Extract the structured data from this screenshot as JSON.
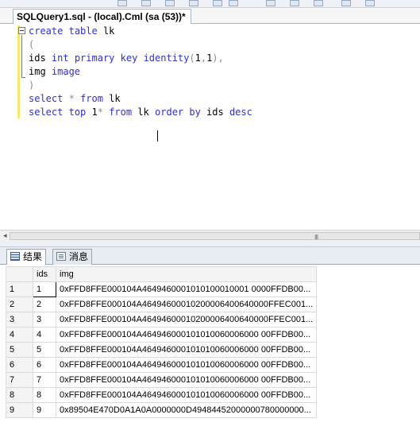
{
  "document_tab": {
    "title": "SQLQuery1.sql - (local).Cml (sa (53))*"
  },
  "editor": {
    "lines": [
      {
        "tokens": [
          {
            "t": "create",
            "c": "kw"
          },
          {
            "t": " "
          },
          {
            "t": "table",
            "c": "kw"
          },
          {
            "t": " lk"
          }
        ]
      },
      {
        "tokens": [
          {
            "t": "(",
            "c": "gray"
          }
        ]
      },
      {
        "tokens": [
          {
            "t": "ids "
          },
          {
            "t": "int",
            "c": "kw"
          },
          {
            "t": " "
          },
          {
            "t": "primary",
            "c": "kw"
          },
          {
            "t": " "
          },
          {
            "t": "key",
            "c": "kw"
          },
          {
            "t": " "
          },
          {
            "t": "identity",
            "c": "kw"
          },
          {
            "t": "(",
            "c": "gray"
          },
          {
            "t": "1"
          },
          {
            "t": ",",
            "c": "gray"
          },
          {
            "t": "1"
          },
          {
            "t": "),",
            "c": "gray"
          }
        ]
      },
      {
        "tokens": [
          {
            "t": "img "
          },
          {
            "t": "image",
            "c": "kw"
          }
        ]
      },
      {
        "tokens": [
          {
            "t": ")",
            "c": "gray"
          }
        ]
      },
      {
        "tokens": [
          {
            "t": "select",
            "c": "kw"
          },
          {
            "t": " "
          },
          {
            "t": "*",
            "c": "gray"
          },
          {
            "t": " "
          },
          {
            "t": "from",
            "c": "kw"
          },
          {
            "t": " lk"
          }
        ]
      },
      {
        "tokens": [
          {
            "t": "select",
            "c": "kw"
          },
          {
            "t": " "
          },
          {
            "t": "top",
            "c": "kw"
          },
          {
            "t": " 1"
          },
          {
            "t": "*",
            "c": "gray"
          },
          {
            "t": " "
          },
          {
            "t": "from",
            "c": "kw"
          },
          {
            "t": " lk "
          },
          {
            "t": "order",
            "c": "kw"
          },
          {
            "t": " "
          },
          {
            "t": "by",
            "c": "kw"
          },
          {
            "t": " ids "
          },
          {
            "t": "desc",
            "c": "kw"
          }
        ]
      }
    ]
  },
  "scrollbar": {
    "left_arrow": "◂",
    "grip": "III"
  },
  "result_tabs": {
    "results_label": "结果",
    "messages_label": "消息"
  },
  "grid": {
    "columns": [
      "ids",
      "img"
    ],
    "rows": [
      {
        "num": "1",
        "ids": "1",
        "img": "0xFFD8FFE000104A4649460001010100010001 0000FFDB00..."
      },
      {
        "num": "2",
        "ids": "2",
        "img": "0xFFD8FFE000104A46494600010200006400640000FFEC001..."
      },
      {
        "num": "3",
        "ids": "3",
        "img": "0xFFD8FFE000104A46494600010200006400640000FFEC001..."
      },
      {
        "num": "4",
        "ids": "4",
        "img": "0xFFD8FFE000104A464946000101010060006000 00FFDB00..."
      },
      {
        "num": "5",
        "ids": "5",
        "img": "0xFFD8FFE000104A464946000101010060006000 00FFDB00..."
      },
      {
        "num": "6",
        "ids": "6",
        "img": "0xFFD8FFE000104A464946000101010060006000 00FFDB00..."
      },
      {
        "num": "7",
        "ids": "7",
        "img": "0xFFD8FFE000104A464946000101010060006000 00FFDB00..."
      },
      {
        "num": "8",
        "ids": "8",
        "img": "0xFFD8FFE000104A464946000101010060006000 00FFDB00..."
      },
      {
        "num": "9",
        "ids": "9",
        "img": "0x89504E470D0A1A0A0000000D49484452000000780000000..."
      }
    ]
  }
}
